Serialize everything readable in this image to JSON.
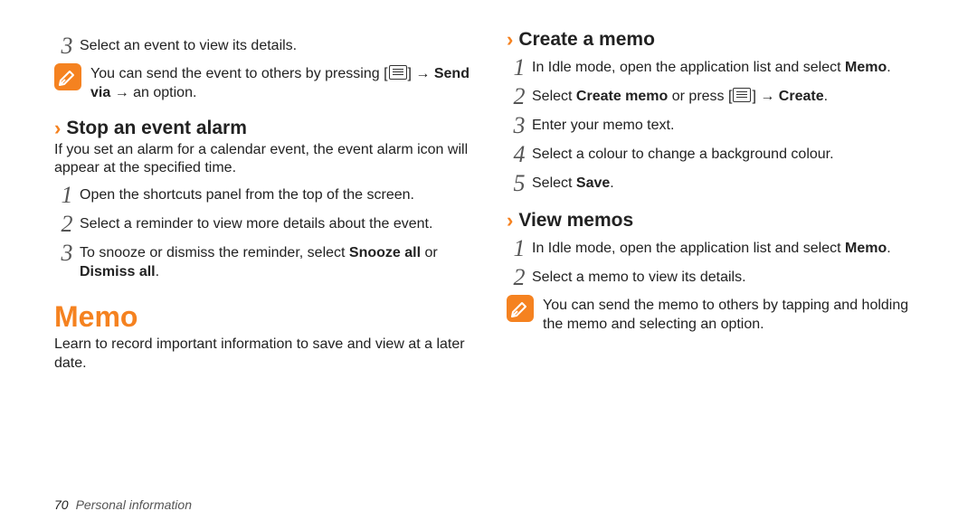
{
  "left": {
    "step3": {
      "num": "3",
      "text": "Select an event to view its details."
    },
    "note1": {
      "pre": "You can send the event to others by pressing [",
      "post": "] ",
      "arrow1": "→ ",
      "bold": "Send via",
      "arrow2": " → an option."
    },
    "stop_heading": "Stop an event alarm",
    "stop_intro": "If you set an alarm for a calendar event, the event alarm icon will appear at the specified time.",
    "stop1": {
      "num": "1",
      "text": "Open the shortcuts panel from the top of the screen."
    },
    "stop2": {
      "num": "2",
      "text": "Select a reminder to view more details about the event."
    },
    "stop3": {
      "num": "3",
      "pre": "To snooze or dismiss the reminder, select ",
      "b1": "Snooze all",
      "mid": " or ",
      "b2": "Dismiss all",
      "post": "."
    },
    "memo_heading": "Memo",
    "memo_intro": "Learn to record important information to save and view at a later date."
  },
  "right": {
    "create_heading": "Create a memo",
    "c1": {
      "num": "1",
      "pre": "In Idle mode, open the application list and select ",
      "bold": "Memo",
      "post": "."
    },
    "c2": {
      "num": "2",
      "pre": "Select ",
      "b1": "Create memo",
      "mid": " or press [",
      "post": "] ",
      "arrow": "→ ",
      "b2": "Create",
      "end": "."
    },
    "c3": {
      "num": "3",
      "text": "Enter your memo text."
    },
    "c4": {
      "num": "4",
      "text": "Select a colour to change a background colour."
    },
    "c5": {
      "num": "5",
      "pre": "Select ",
      "bold": "Save",
      "post": "."
    },
    "view_heading": "View memos",
    "v1": {
      "num": "1",
      "pre": "In Idle mode, open the application list and select ",
      "bold": "Memo",
      "post": "."
    },
    "v2": {
      "num": "2",
      "text": "Select a memo to view its details."
    },
    "note2": {
      "text": "You can send the memo to others by tapping and holding the memo and selecting an option."
    }
  },
  "footer": {
    "page": "70",
    "section": "Personal information"
  }
}
